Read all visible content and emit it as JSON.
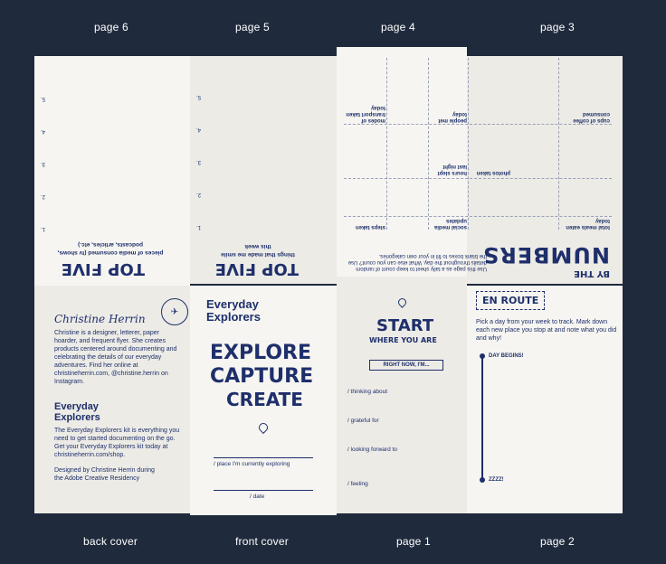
{
  "labels": {
    "page6": "page 6",
    "page5": "page 5",
    "page4": "page 4",
    "page3": "page 3",
    "back_cover": "back cover",
    "front_cover": "front cover",
    "page1": "page 1",
    "page2": "page 2"
  },
  "top5_a": {
    "title": "TOP FIVE",
    "subtitle": "pieces of media consumed (tv shows, podcasts, articles, etc.)",
    "numbers": [
      "1.",
      "2.",
      "3.",
      "4.",
      "5."
    ]
  },
  "top5_b": {
    "title": "TOP FIVE",
    "subtitle": "things that made me smile this week",
    "numbers": [
      "1.",
      "2.",
      "3.",
      "4.",
      "5."
    ]
  },
  "numbers_page": {
    "title_small": "BY THE",
    "title_big": "NUMBERS",
    "intro": "Use this page as a tally sheet to keep count of random details throughout the day. What else can you count? Use the blank boxes to fill in your own categories.",
    "cells": [
      "steps taken",
      "social media updates",
      "hours slept last night",
      "people met today",
      "modes of transport taken today",
      "photos taken",
      "total meals eaten today",
      "cups of coffee consumed"
    ]
  },
  "back_cover": {
    "signature": "Christine Herrin",
    "bio": "Christine is a designer, letterer, paper hoarder, and frequent flyer. She creates products centered around documenting and celebrating the details of our everyday adventures. Find her online at christineherrin.com, @christine.herrin on Instagram.",
    "kit_title": "Everyday Explorers",
    "kit_text": "The Everyday Explorers kit is everything you need to get started documenting on the go. Get your Everyday Explorers kit today at christineherrin.com/shop.",
    "credit": "Designed by Christine Herrin during the Adobe Creative Residency",
    "badge": "EVERYDAY EXPLORERS"
  },
  "front_cover": {
    "title": "Everyday Explorers",
    "line1": "EXPLORE",
    "line2": "CAPTURE",
    "line3": "CREATE",
    "field1": "/ place I'm currently exploring",
    "field2": "/ date"
  },
  "page1": {
    "start": "START",
    "where": "WHERE YOU ARE",
    "banner": "RIGHT NOW, I'M...",
    "prompts": [
      "/ thinking about",
      "/ grateful for",
      "/ looking forward to",
      "/ feeling"
    ]
  },
  "page2": {
    "title": "EN ROUTE",
    "text": "Pick a day from your week to track. Mark down each new place you stop at and note what you did and why!",
    "start_label": "DAY BEGINS!",
    "end_label": "ZZZZ!"
  }
}
